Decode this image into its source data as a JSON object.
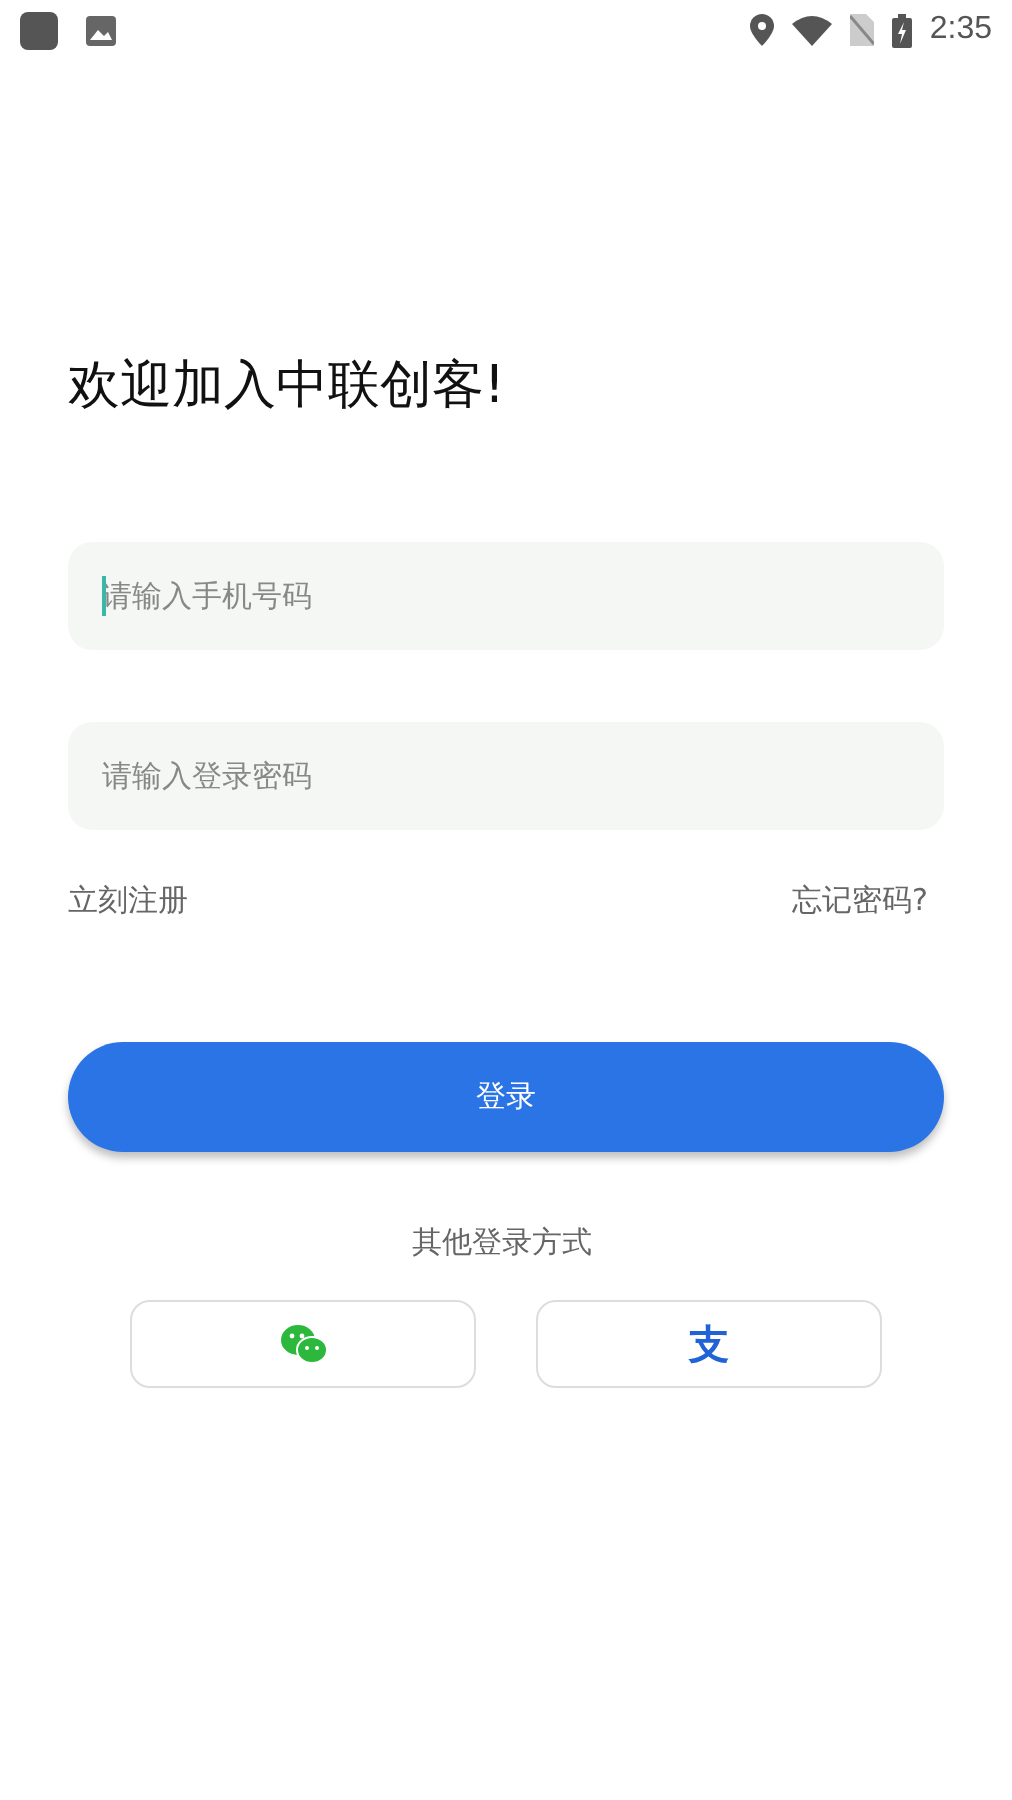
{
  "status_bar": {
    "time": "2:35"
  },
  "title": "欢迎加入中联创客!",
  "fields": [
    {
      "placeholder": "请输入手机号码",
      "focused": true
    },
    {
      "placeholder": "请输入登录密码",
      "focused": false
    }
  ],
  "links": [
    "立刻注册",
    "忘记密码?"
  ],
  "login_button": "登录",
  "other_login": {
    "label": "其他登录方式",
    "options": [
      {
        "kind": "wechat"
      },
      {
        "kind": "alipay",
        "glyph": "支"
      }
    ]
  }
}
